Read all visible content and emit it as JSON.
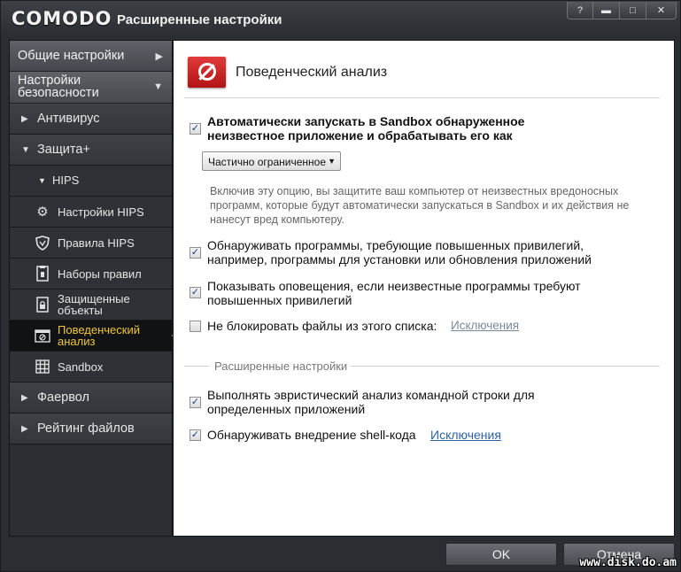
{
  "window": {
    "brand": "COMODO",
    "title": "Расширенные настройки",
    "controls": [
      "?",
      "▬",
      "□",
      "✕"
    ]
  },
  "sidebar": {
    "general": "Общие настройки",
    "security": "Настройки безопасности",
    "antivirus": "Антивирус",
    "defense": "Защита+",
    "hips": "HIPS",
    "hips_settings": "Настройки HIPS",
    "hips_rules": "Правила HIPS",
    "rulesets": "Наборы правил",
    "protected": "Защищенные объекты",
    "behavior": "Поведенческий анализ",
    "sandbox": "Sandbox",
    "firewall": "Фаервол",
    "file_rating": "Рейтинг файлов"
  },
  "main": {
    "title": "Поведенческий анализ",
    "auto_sandbox": {
      "checked": true,
      "label_line1": "Автоматически запускать в Sandbox обнаруженное",
      "label_line2": "неизвестное приложение и обрабатывать его как"
    },
    "restriction_select": "Частично ограниченное",
    "hint_line1": "Включив эту опцию, вы защитите ваш компьютер от неизвестных вредоносных",
    "hint_line2": "программ, которые будут автоматически запускаться в Sandbox и их действия не",
    "hint_line3": "нанесут вред компьютеру.",
    "detect_elevated": {
      "checked": true,
      "line1": "Обнаруживать программы, требующие повышенных привилегий,",
      "line2": "например, программы для установки или обновления приложений"
    },
    "show_alerts": {
      "checked": true,
      "line1": "Показывать оповещения, если неизвестные программы требуют",
      "line2": "повышенных привилегий"
    },
    "dont_block": {
      "checked": false,
      "label": "Не блокировать файлы из этого списка:",
      "link": "Исключения"
    },
    "advanced_label": "Расширенные настройки",
    "heuristic_cmd": {
      "checked": true,
      "line1": "Выполнять эвристический анализ командной строки для",
      "line2": "определенных приложений"
    },
    "shellcode": {
      "checked": true,
      "label": "Обнаруживать внедрение shell-кода",
      "link": "Исключения"
    }
  },
  "buttons": {
    "ok": "OK",
    "cancel": "Отмена"
  },
  "watermark": "www.disk.do.am"
}
